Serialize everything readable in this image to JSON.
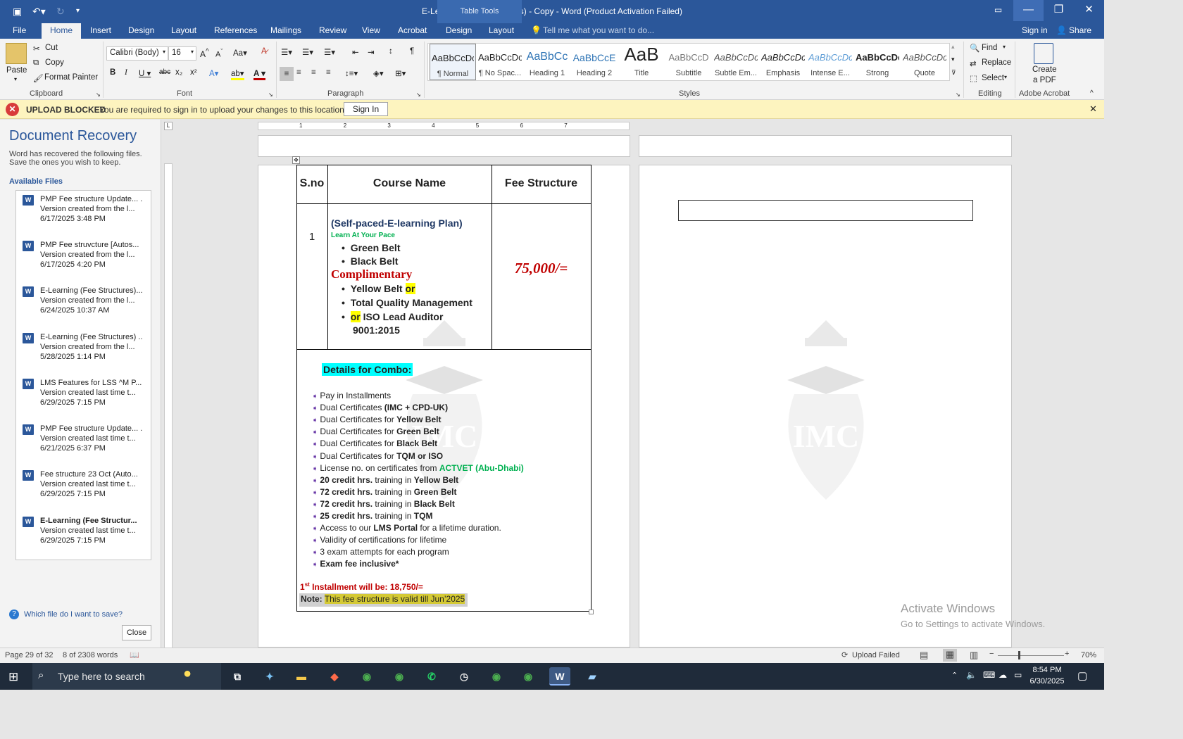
{
  "titlebar": {
    "title": "E-Learning (Fee Structures) - Copy - Word (Product Activation Failed)",
    "table_tools": "Table Tools"
  },
  "tabs": [
    "File",
    "Home",
    "Insert",
    "Design",
    "Layout",
    "References",
    "Mailings",
    "Review",
    "View",
    "Acrobat",
    "Design",
    "Layout"
  ],
  "tell_me": "Tell me what you want to do...",
  "sign_in": "Sign in",
  "share": "Share",
  "clipboard": {
    "paste": "Paste",
    "cut": "Cut",
    "copy": "Copy",
    "format_painter": "Format Painter",
    "label": "Clipboard"
  },
  "font": {
    "name": "Calibri (Body)",
    "size": "16",
    "label": "Font"
  },
  "paragraph": {
    "label": "Paragraph"
  },
  "styles": {
    "label": "Styles",
    "items": [
      {
        "preview": "AaBbCcDc",
        "name": "¶ Normal"
      },
      {
        "preview": "AaBbCcDc",
        "name": "¶ No Spac..."
      },
      {
        "preview": "AaBbCc",
        "name": "Heading 1"
      },
      {
        "preview": "AaBbCcE",
        "name": "Heading 2"
      },
      {
        "preview": "AaB",
        "name": "Title"
      },
      {
        "preview": "AaBbCcD",
        "name": "Subtitle"
      },
      {
        "preview": "AaBbCcDc",
        "name": "Subtle Em..."
      },
      {
        "preview": "AaBbCcDc",
        "name": "Emphasis"
      },
      {
        "preview": "AaBbCcDc",
        "name": "Intense E..."
      },
      {
        "preview": "AaBbCcDc",
        "name": "Strong"
      },
      {
        "preview": "AaBbCcDc",
        "name": "Quote"
      }
    ]
  },
  "editing": {
    "find": "Find",
    "replace": "Replace",
    "select": "Select",
    "label": "Editing"
  },
  "acrobat": {
    "create_pdf_1": "Create",
    "create_pdf_2": "a PDF",
    "label": "Adobe Acrobat"
  },
  "message_bar": {
    "title": "UPLOAD BLOCKED",
    "text": "You are required to sign in to upload your changes to this location.",
    "button": "Sign In"
  },
  "recovery": {
    "title": "Document Recovery",
    "desc1": "Word has recovered the following files.",
    "desc2": "Save the ones you wish to keep.",
    "available": "Available Files",
    "files": [
      {
        "name": "PMP Fee structure Update... .",
        "desc": "Version created from the l...",
        "date": "6/17/2025 3:48 PM"
      },
      {
        "name": "PMP Fee struvcture  [Autos...",
        "desc": "Version created from the l...",
        "date": "6/17/2025 4:20 PM"
      },
      {
        "name": "E-Learning (Fee Structures)...",
        "desc": "Version created from the l...",
        "date": "6/24/2025 10:37 AM"
      },
      {
        "name": "E-Learning (Fee Structures) ..",
        "desc": "Version created from the l...",
        "date": "5/28/2025 1:14 PM"
      },
      {
        "name": "LMS Features for LSS ^M P...",
        "desc": "Version created last time t...",
        "date": "6/29/2025 7:15 PM"
      },
      {
        "name": "PMP Fee structure Update... .",
        "desc": "Version created last time t...",
        "date": "6/21/2025 6:37 PM"
      },
      {
        "name": "Fee structure 23 Oct (Auto...",
        "desc": "Version created last time t...",
        "date": "6/29/2025 7:15 PM"
      },
      {
        "name": "E-Learning (Fee Structur...",
        "desc": "Version created last time t...",
        "date": "6/29/2025 7:15 PM"
      }
    ],
    "which_file": "Which file do I want to save?",
    "close": "Close"
  },
  "document": {
    "headers": [
      "S.no",
      "Course Name",
      "Fee Structure"
    ],
    "sno": "1",
    "plan": "(Self-paced-E-learning Plan)",
    "pace": "Learn At Your Pace",
    "belts": [
      "Green Belt",
      "Black Belt"
    ],
    "complimentary": "Complimentary",
    "comp1": "Yellow Belt",
    "or": "or",
    "comp2": "Total Quality Management",
    "comp3a": "ISO Lead Auditor",
    "comp3b": "9001:2015",
    "fee": "75,000/=",
    "combo_title": "Details for Combo:",
    "combo": [
      {
        "a": "Pay in Installments",
        "b": "",
        "c": ""
      },
      {
        "a": "Dual Certificates ",
        "b": "(IMC + CPD-UK)",
        "c": ""
      },
      {
        "a": "Dual Certificates for ",
        "b": "Yellow Belt",
        "c": ""
      },
      {
        "a": "Dual Certificates for ",
        "b": "Green Belt",
        "c": ""
      },
      {
        "a": "Dual Certificates for ",
        "b": "Black Belt",
        "c": ""
      },
      {
        "a": "Dual Certificates for ",
        "b": "TQM or ISO",
        "c": ""
      },
      {
        "a": "License no. on certificates from ",
        "b": "ACTVET (Abu-Dhabi)",
        "c": ""
      },
      {
        "a": "",
        "b": "20 credit hrs.",
        "c": " training in ",
        "d": "Yellow Belt"
      },
      {
        "a": "",
        "b": "72 credit hrs.",
        "c": " training in ",
        "d": "Green Belt"
      },
      {
        "a": "",
        "b": "72 credit hrs.",
        "c": " training in ",
        "d": "Black Belt"
      },
      {
        "a": "",
        "b": "25 credit hrs.",
        "c": " training in ",
        "d": "TQM"
      },
      {
        "a": "Access to our ",
        "b": "LMS Portal",
        "c": " for a lifetime duration."
      },
      {
        "a": "Validity of certifications for lifetime",
        "b": "",
        "c": ""
      },
      {
        "a": "3 exam attempts for each program",
        "b": "",
        "c": ""
      },
      {
        "a": "",
        "b": "Exam fee inclusive*",
        "c": ""
      }
    ],
    "installment_pre": "1",
    "installment_sup": "st",
    "installment": " Installment will be: 18,750/=",
    "note_label": "Note:",
    "note": "This fee structure is valid till Jun’2025",
    "watermark_text": "IMC"
  },
  "status": {
    "page": "Page 29 of 32",
    "words": "8 of 2308 words",
    "upload": "Upload Failed",
    "zoom": "70%"
  },
  "activate": {
    "title": "Activate Windows",
    "sub": "Go to Settings to activate Windows."
  },
  "taskbar": {
    "search": "Type here to search",
    "time": "8:54 PM",
    "date": "6/30/2025"
  },
  "colors": {
    "word_blue": "#2b579a",
    "fee_red": "#c00000",
    "plan_blue": "#1f3864",
    "green": "#00b050",
    "cyan": "#00ffff",
    "yellow": "#ffff00"
  }
}
